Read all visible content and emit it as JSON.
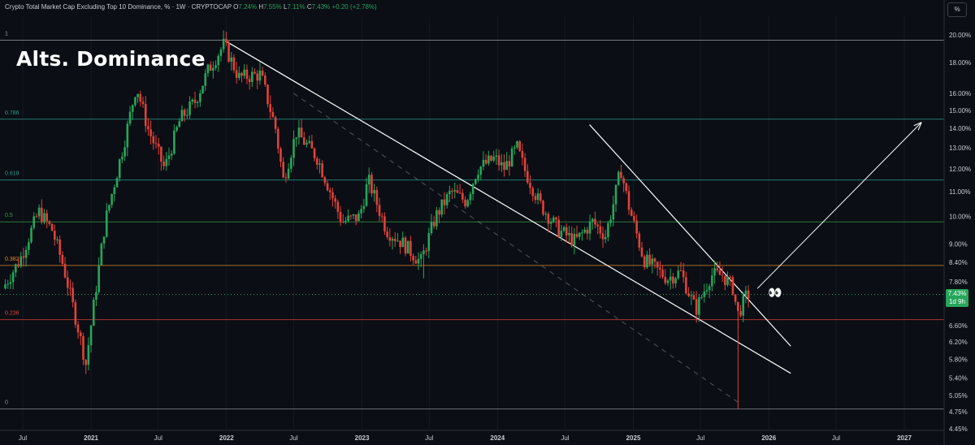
{
  "legend": {
    "symbol": "Crypto Total Market Cap Excluding Top 10 Dominance, % · 1W · CRYPTOCAP",
    "o_label": "O",
    "o_value": "7.24%",
    "h_label": "H",
    "h_value": "7.55%",
    "l_label": "L",
    "l_value": "7.11%",
    "c_label": "C",
    "c_value": "7.43%",
    "change": "+0.20 (+2.78%)"
  },
  "overlay_title": "Alts. Dominance",
  "unit_button": "%",
  "price_badge": {
    "price": "7.43%",
    "countdown": "1d 9h"
  },
  "colors": {
    "background": "#0b0e14",
    "up": "#26a65b",
    "down": "#e0423a",
    "grid": "#1c212b",
    "trendline": "#ffffff"
  },
  "chart_data": {
    "type": "candlestick",
    "title": "Alts. Dominance",
    "xlabel": "",
    "ylabel": "",
    "y_scale": "log",
    "ylim": [
      4.45,
      21.2
    ],
    "y_ticks": [
      "20.00%",
      "18.00%",
      "16.00%",
      "15.00%",
      "14.00%",
      "13.00%",
      "12.00%",
      "11.00%",
      "10.00%",
      "9.00%",
      "8.40%",
      "7.80%",
      "6.60%",
      "6.20%",
      "5.80%",
      "5.40%",
      "5.05%",
      "4.75%",
      "4.45%"
    ],
    "x_ticks": [
      "Jul",
      "2021",
      "Jul",
      "2022",
      "Jul",
      "2023",
      "Jul",
      "2024",
      "Jul",
      "2025",
      "Jul",
      "2026",
      "Jul",
      "2027"
    ],
    "series_path": [
      [
        "2020-05-15",
        7.6
      ],
      [
        "2020-07-01",
        8.5
      ],
      [
        "2020-08-20",
        10.2
      ],
      [
        "2020-09-25",
        9.5
      ],
      [
        "2020-10-25",
        8.3
      ],
      [
        "2020-12-05",
        6.5
      ],
      [
        "2020-12-25",
        5.7
      ],
      [
        "2021-01-20",
        7.5
      ],
      [
        "2021-02-15",
        9.8
      ],
      [
        "2021-04-10",
        13.5
      ],
      [
        "2021-05-10",
        16.5
      ],
      [
        "2021-06-10",
        14.0
      ],
      [
        "2021-07-25",
        12.0
      ],
      [
        "2021-09-05",
        14.5
      ],
      [
        "2021-10-15",
        15.5
      ],
      [
        "2021-11-20",
        17.5
      ],
      [
        "2022-01-01",
        19.3
      ],
      [
        "2022-02-10",
        17.0
      ],
      [
        "2022-04-10",
        17.2
      ],
      [
        "2022-05-20",
        14.0
      ],
      [
        "2022-06-10",
        11.5
      ],
      [
        "2022-07-15",
        13.8
      ],
      [
        "2022-09-10",
        12.5
      ],
      [
        "2022-11-15",
        9.8
      ],
      [
        "2023-01-01",
        10.0
      ],
      [
        "2023-01-25",
        11.5
      ],
      [
        "2023-03-15",
        9.5
      ],
      [
        "2023-05-01",
        9.0
      ],
      [
        "2023-06-15",
        8.4
      ],
      [
        "2023-07-25",
        10.0
      ],
      [
        "2023-09-05",
        11.0
      ],
      [
        "2023-10-15",
        10.6
      ],
      [
        "2023-11-15",
        12.0
      ],
      [
        "2024-01-01",
        12.5
      ],
      [
        "2024-01-25",
        12.0
      ],
      [
        "2024-03-01",
        13.0
      ],
      [
        "2024-03-20",
        12.0
      ],
      [
        "2024-05-01",
        10.5
      ],
      [
        "2024-06-20",
        9.5
      ],
      [
        "2024-08-05",
        9.1
      ],
      [
        "2024-09-20",
        9.8
      ],
      [
        "2024-10-25",
        9.3
      ],
      [
        "2024-11-15",
        10.5
      ],
      [
        "2024-12-05",
        12.0
      ],
      [
        "2024-12-25",
        10.5
      ],
      [
        "2025-02-05",
        8.5
      ],
      [
        "2025-04-10",
        7.9
      ],
      [
        "2025-05-15",
        8.1
      ],
      [
        "2025-06-25",
        7.0
      ],
      [
        "2025-08-05",
        8.0
      ],
      [
        "2025-09-05",
        8.0
      ],
      [
        "2025-10-05",
        7.6
      ],
      [
        "2025-10-15",
        6.85
      ],
      [
        "2025-11-10",
        7.43
      ]
    ],
    "wick_extremes": [
      {
        "date": "2022-01-01",
        "high": 19.6
      },
      {
        "date": "2020-12-25",
        "low": 5.6
      },
      {
        "date": "2023-06-15",
        "low": 7.9
      },
      {
        "date": "2025-10-10",
        "low": 4.8
      }
    ],
    "fib_levels": [
      {
        "label": "1",
        "value": 19.6,
        "color": "#9aa0aa"
      },
      {
        "label": "0.786",
        "value": 14.5,
        "color": "#2a9d8f"
      },
      {
        "label": "0.618",
        "value": 11.5,
        "color": "#2a9d8f"
      },
      {
        "label": "0.5",
        "value": 9.8,
        "color": "#3a9d4a"
      },
      {
        "label": "0.382",
        "value": 8.3,
        "color": "#e08a2a"
      },
      {
        "label": "0.236",
        "value": 6.75,
        "color": "#e0423a"
      },
      {
        "label": "0",
        "value": 4.8,
        "color": "#8a8f99"
      }
    ],
    "current_price_line": 7.43,
    "trendlines": [
      {
        "from": [
          "2022-01-01",
          19.5
        ],
        "to": [
          "2026-03-01",
          5.5
        ]
      },
      {
        "from": [
          "2024-09-05",
          14.2
        ],
        "to": [
          "2026-03-01",
          6.1
        ]
      },
      {
        "from": [
          "2022-07-01",
          16.0
        ],
        "to": [
          "2025-10-15",
          4.9
        ],
        "dashed": true
      },
      {
        "from": [
          "2025-12-01",
          7.6
        ],
        "to": [
          "2027-02-15",
          14.3
        ],
        "arrow": true
      }
    ],
    "annotation_emoji": "👀"
  }
}
